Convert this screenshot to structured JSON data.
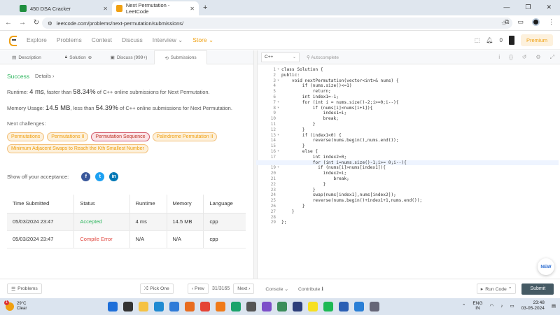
{
  "browser": {
    "tabs": [
      {
        "title": "450 DSA Cracker",
        "favicon_color": "#1e8e3e"
      },
      {
        "title": "Next Permutation - LeetCode",
        "favicon_color": "#f0a011"
      }
    ],
    "url": "leetcode.com/problems/next-permutation/submissions/"
  },
  "nav": {
    "links": [
      "Explore",
      "Problems",
      "Contest",
      "Discuss",
      "Interview ⌄",
      "Store ⌄"
    ],
    "notifications": "0",
    "premium": "Premium"
  },
  "left_tabs": [
    "Description",
    "Solution",
    "Discuss (999+)",
    "Submissions"
  ],
  "result": {
    "status": "Success",
    "details": "Details ›",
    "runtime_prefix": "Runtime: ",
    "runtime_value": "4 ms",
    "runtime_mid": ", faster than ",
    "runtime_pct": "58.34%",
    "runtime_suffix": " of C++ online submissions for Next Permutation.",
    "memory_prefix": "Memory Usage: ",
    "memory_value": "14.5 MB",
    "memory_mid": ", less than ",
    "memory_pct": "54.39%",
    "memory_suffix": " of C++ online submissions for Next Permutation."
  },
  "next_challenges": {
    "label": "Next challenges:",
    "items": [
      {
        "text": "Permutations",
        "difficulty": "medium"
      },
      {
        "text": "Permutations II",
        "difficulty": "medium"
      },
      {
        "text": "Permutation Sequence",
        "difficulty": "hard"
      },
      {
        "text": "Palindrome Permutation II",
        "difficulty": "medium"
      },
      {
        "text": "Minimum Adjacent Swaps to Reach the Kth Smallest Number",
        "difficulty": "medium"
      }
    ]
  },
  "share_label": "Show off your acceptance:",
  "submissions": {
    "headers": [
      "Time Submitted",
      "Status",
      "Runtime",
      "Memory",
      "Language"
    ],
    "rows": [
      {
        "time": "05/03/2024 23:47",
        "status": "Accepted",
        "runtime": "4 ms",
        "memory": "14.5 MB",
        "language": "cpp"
      },
      {
        "time": "05/03/2024 23:47",
        "status": "Compile Error",
        "runtime": "N/A",
        "memory": "N/A",
        "language": "cpp"
      }
    ]
  },
  "editor": {
    "language": "C++",
    "autocomplete": "Autocomplete",
    "lines": [
      "class Solution {",
      "public:",
      "    void nextPermutation(vector<int>& nums) {",
      "        if (nums.size()<=1)",
      "            return;",
      "        int index1=-1;",
      "        for (int i = nums.size()-2;i>=0;i--){",
      "            if (nums[i]<nums[i+1]){",
      "                index1=i;",
      "                break;",
      "            }",
      "        }",
      "        if (index1<0) {",
      "            reverse(nums.begin(),nums.end());",
      "        }",
      "        else {",
      "            int index2=0;",
      "            for (int i=nums.size()-1;i>= 0;i--){",
      "              if (nums[i]>nums[index1]){",
      "                index2=i;",
      "                    break;",
      "                }",
      "            }",
      "            swap(nums[index1],nums[index2]);",
      "            reverse(nums.begin()+index1+1,nums.end());",
      "        }",
      "    }",
      "",
      "};"
    ],
    "new_badge": "NEW"
  },
  "bottom": {
    "problems": "Problems",
    "pick_one": "Pick One",
    "prev": "‹ Prev",
    "page": "31/3165",
    "next": "Next ›",
    "console": "Console ⌄",
    "contribute": "Contribute ℹ",
    "run_code": "Run Code ⌃",
    "submit": "Submit"
  },
  "taskbar": {
    "temp": "29°C",
    "weather": "Clear",
    "badge": "1",
    "lang_top": "ENG",
    "lang_bottom": "IN",
    "time": "23:48",
    "date": "03-05-2024"
  }
}
